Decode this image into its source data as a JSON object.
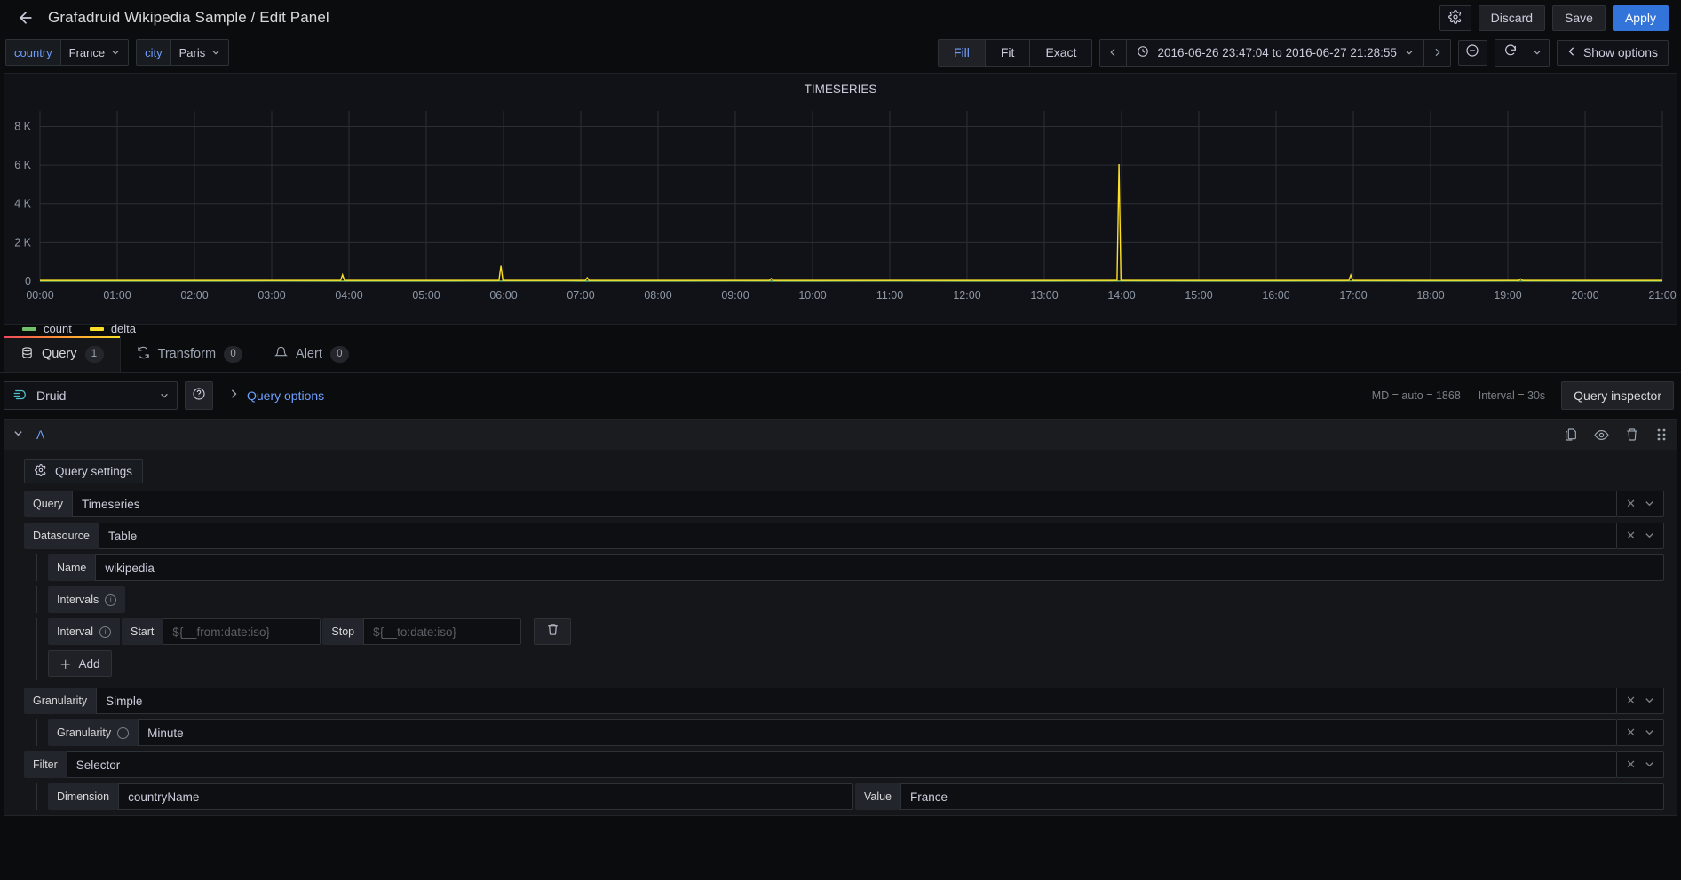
{
  "header": {
    "back_icon": "arrow-left-icon",
    "title": "Grafadruid Wikipedia Sample / Edit Panel",
    "settings_icon": "gear-icon",
    "discard_label": "Discard",
    "save_label": "Save",
    "apply_label": "Apply",
    "apply_color": "#3274d9"
  },
  "variables": [
    {
      "label": "country",
      "value": "France",
      "caret": "chevron-down-icon"
    },
    {
      "label": "city",
      "value": "Paris",
      "caret": "chevron-down-icon"
    }
  ],
  "timebar": {
    "zoom_modes": [
      {
        "label": "Fill",
        "active": true
      },
      {
        "label": "Fit",
        "active": false
      },
      {
        "label": "Exact",
        "active": false
      }
    ],
    "prev_icon": "chevron-left-icon",
    "clock_icon": "clock-icon",
    "range": "2016-06-26 23:47:04 to 2016-06-27 21:28:55",
    "range_caret": "chevron-down-icon",
    "next_icon": "chevron-right-icon",
    "zoom_out_icon": "zoom-out-icon",
    "refresh_icon": "refresh-icon",
    "refresh_caret": "chevron-down-icon",
    "show_options_icon": "chevron-left-icon",
    "show_options_label": "Show options"
  },
  "chart_data": {
    "type": "line",
    "title": "TIMESERIES",
    "xlabel": "",
    "ylabel": "",
    "grid": true,
    "legend_position": "bottom-left",
    "ylim": [
      0,
      8800
    ],
    "yticks": [
      0,
      2000,
      4000,
      6000,
      8000
    ],
    "ytick_labels": [
      "0",
      "2 K",
      "4 K",
      "6 K",
      "8 K"
    ],
    "xticks": [
      "00:00",
      "01:00",
      "02:00",
      "03:00",
      "04:00",
      "05:00",
      "06:00",
      "07:00",
      "08:00",
      "09:00",
      "10:00",
      "11:00",
      "12:00",
      "13:00",
      "14:00",
      "15:00",
      "16:00",
      "17:00",
      "18:00",
      "19:00",
      "20:00",
      "21:00"
    ],
    "series": [
      {
        "name": "count",
        "color": "#73bf69",
        "values": [
          5,
          6,
          5,
          7,
          6,
          5,
          8,
          6,
          5,
          7,
          6,
          8,
          5,
          6,
          7,
          5,
          6,
          8,
          5,
          7,
          6,
          5
        ]
      },
      {
        "name": "delta",
        "color": "#fade2a",
        "spikes": [
          {
            "x": "03:55",
            "y": 330
          },
          {
            "x": "05:58",
            "y": 800
          },
          {
            "x": "07:05",
            "y": 180
          },
          {
            "x": "09:28",
            "y": 140
          },
          {
            "x": "13:58",
            "y": 6050
          },
          {
            "x": "16:58",
            "y": 320
          },
          {
            "x": "19:10",
            "y": 120
          }
        ],
        "baseline": 40
      }
    ]
  },
  "tabs": [
    {
      "label": "Query",
      "badge": "1",
      "icon": "database-icon",
      "active": true
    },
    {
      "label": "Transform",
      "badge": "0",
      "icon": "transform-icon",
      "active": false
    },
    {
      "label": "Alert",
      "badge": "0",
      "icon": "bell-icon",
      "active": false
    }
  ],
  "datasource_row": {
    "datasource_icon": "druid-icon",
    "datasource": "Druid",
    "caret": "chevron-down-icon",
    "help_icon": "question-circle-icon",
    "expand_icon": "chevron-right-icon",
    "query_options_label": "Query options",
    "max_data_points": "MD = auto = 1868",
    "interval": "Interval = 30s",
    "inspector_label": "Query inspector"
  },
  "query": {
    "caret": "chevron-down-icon",
    "ref_id": "A",
    "actions": [
      {
        "name": "duplicate-query-icon",
        "glyph": "copy"
      },
      {
        "name": "hide-query-icon",
        "glyph": "eye"
      },
      {
        "name": "delete-query-icon",
        "glyph": "trash"
      },
      {
        "name": "drag-handle-icon",
        "glyph": "drag"
      }
    ],
    "settings_button": {
      "icon": "gear-icon",
      "label": "Query settings"
    },
    "fields": {
      "query": {
        "label": "Query",
        "value": "Timeseries"
      },
      "datasource": {
        "label": "Datasource",
        "value": "Table"
      },
      "name": {
        "label": "Name",
        "value": "wikipedia"
      },
      "intervals": {
        "label": "Intervals"
      },
      "interval": {
        "label": "Interval",
        "start_label": "Start",
        "start_placeholder": "${__from:date:iso}",
        "stop_label": "Stop",
        "stop_placeholder": "${__to:date:iso}",
        "delete_icon": "trash-icon"
      },
      "add_label": "Add",
      "granularity_outer": {
        "label": "Granularity",
        "value": "Simple"
      },
      "granularity_inner": {
        "label": "Granularity",
        "value": "Minute"
      },
      "filter": {
        "label": "Filter",
        "value": "Selector"
      },
      "dimension": {
        "label": "Dimension",
        "value": "countryName"
      },
      "value": {
        "label": "Value",
        "value": "France"
      }
    },
    "clear_icon": "times-icon",
    "dropdown_icon": "chevron-down-icon"
  }
}
